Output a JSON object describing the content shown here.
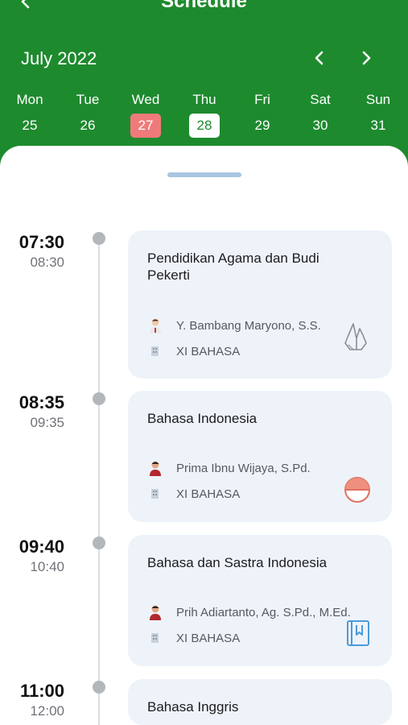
{
  "header": {
    "title": "Schedule",
    "month": "July 2022",
    "days": [
      {
        "name": "Mon",
        "num": "25",
        "state": "normal"
      },
      {
        "name": "Tue",
        "num": "26",
        "state": "normal"
      },
      {
        "name": "Wed",
        "num": "27",
        "state": "today"
      },
      {
        "name": "Thu",
        "num": "28",
        "state": "selected"
      },
      {
        "name": "Fri",
        "num": "29",
        "state": "normal"
      },
      {
        "name": "Sat",
        "num": "30",
        "state": "normal"
      },
      {
        "name": "Sun",
        "num": "31",
        "state": "normal"
      }
    ]
  },
  "schedule": [
    {
      "start": "07:30",
      "end": "08:30",
      "subject": "Pendidikan Agama dan Budi Pekerti",
      "teacher": "Y. Bambang Maryono, S.S.",
      "class": "XI BAHASA",
      "icon": "praying-hands-icon"
    },
    {
      "start": "08:35",
      "end": "09:35",
      "subject": "Bahasa Indonesia",
      "teacher": "Prima Ibnu Wijaya, S.Pd.",
      "class": "XI BAHASA",
      "icon": "indonesia-flag-icon"
    },
    {
      "start": "09:40",
      "end": "10:40",
      "subject": "Bahasa dan Sastra Indonesia",
      "teacher": "Prih Adiartanto, Ag. S.Pd., M.Ed.",
      "class": "XI BAHASA",
      "icon": "book-bookmark-icon"
    },
    {
      "start": "11:00",
      "end": "12:00",
      "subject": "Bahasa Inggris",
      "teacher": "",
      "class": "",
      "icon": ""
    }
  ],
  "colors": {
    "header_bg": "#1e8a2e",
    "today_bg": "#f07a7a",
    "card_bg": "#eef3fa"
  }
}
